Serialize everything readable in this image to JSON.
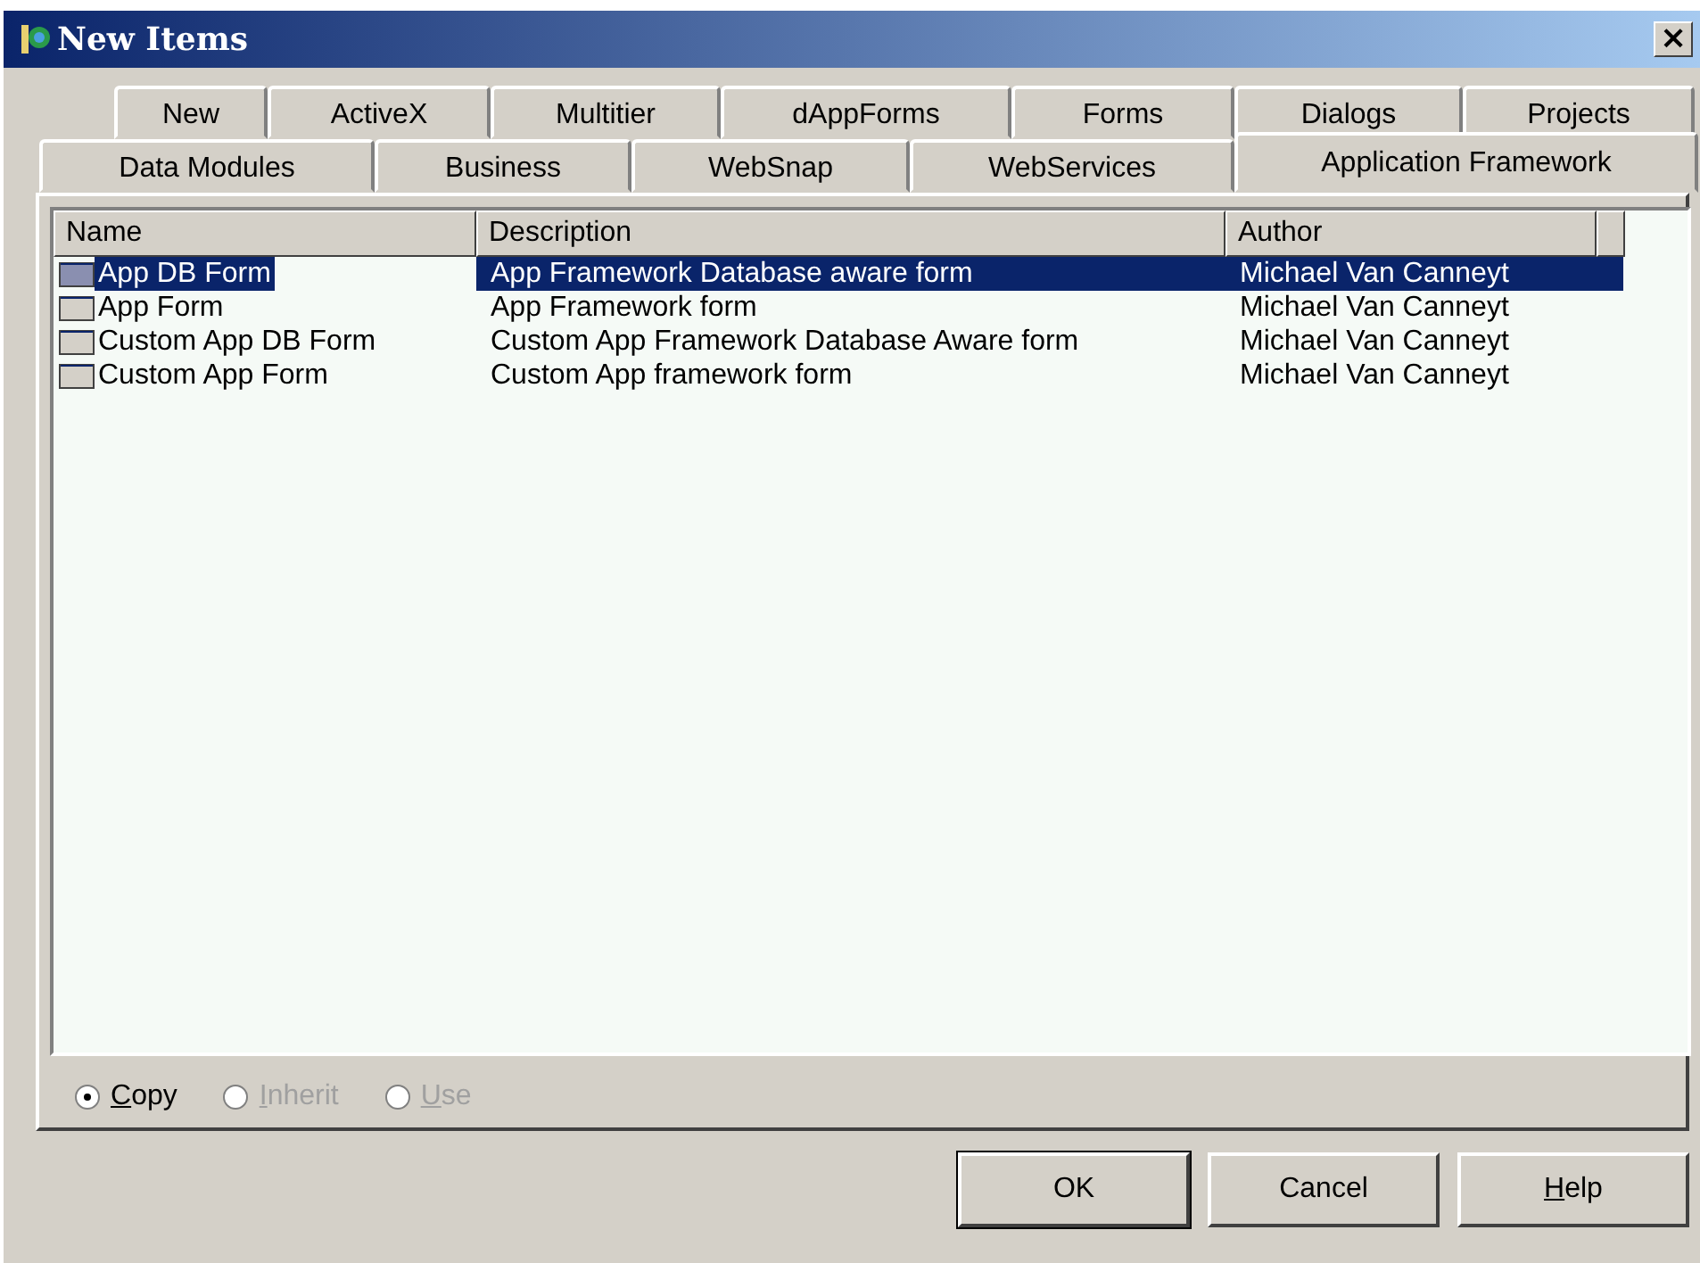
{
  "window": {
    "title": "New Items",
    "close_glyph": "×"
  },
  "tab_rows": [
    {
      "tabs": [
        {
          "label": "New",
          "selected": false
        },
        {
          "label": "ActiveX",
          "selected": false
        },
        {
          "label": "Multitier",
          "selected": false
        },
        {
          "label": "dAppForms",
          "selected": false
        },
        {
          "label": "Forms",
          "selected": false
        },
        {
          "label": "Dialogs",
          "selected": false
        },
        {
          "label": "Projects",
          "selected": false
        }
      ]
    },
    {
      "tabs": [
        {
          "label": "Data Modules",
          "selected": false
        },
        {
          "label": "Business",
          "selected": false
        },
        {
          "label": "WebSnap",
          "selected": false
        },
        {
          "label": "WebServices",
          "selected": false
        },
        {
          "label": "Application Framework",
          "selected": true
        }
      ]
    }
  ],
  "table": {
    "columns": [
      "Name",
      "Description",
      "Author"
    ],
    "rows": [
      {
        "name": "App DB Form",
        "description": "App Framework Database aware form",
        "author": "Michael Van Canneyt",
        "selected": true
      },
      {
        "name": "App Form",
        "description": "App Framework form",
        "author": "Michael Van Canneyt",
        "selected": false
      },
      {
        "name": "Custom App DB Form",
        "description": "Custom App Framework Database Aware form",
        "author": "Michael Van Canneyt",
        "selected": false
      },
      {
        "name": "Custom App Form",
        "description": "Custom App framework form",
        "author": "Michael Van Canneyt",
        "selected": false
      }
    ]
  },
  "options": [
    {
      "label": "Copy",
      "selected": true,
      "disabled": false
    },
    {
      "label": "Inherit",
      "selected": false,
      "disabled": true
    },
    {
      "label": "Use",
      "selected": false,
      "disabled": true
    }
  ],
  "buttons": [
    {
      "label": "OK",
      "default": true,
      "mnemonic": false
    },
    {
      "label": "Cancel",
      "default": false,
      "mnemonic": false
    },
    {
      "label": "Help",
      "default": false,
      "mnemonic": true
    }
  ]
}
